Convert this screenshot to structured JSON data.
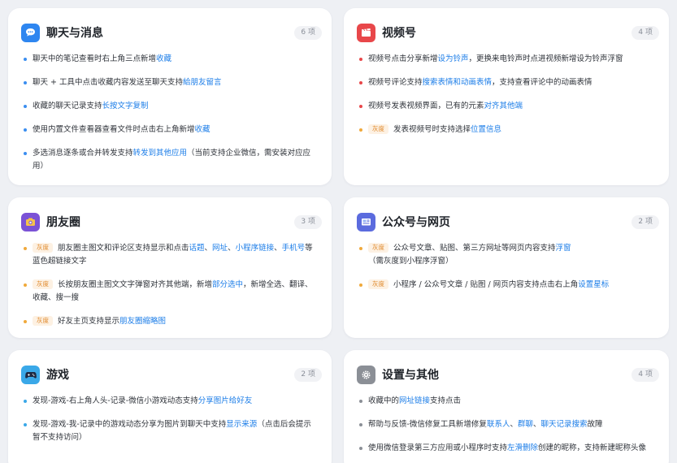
{
  "colors": {
    "accent_link": "#1d7ee8",
    "badge_orange": "#e0892b",
    "chat_icon": "#2e86f0",
    "channels_icon": "#e8474a",
    "moments_icon": "#7b52d6",
    "official_icon": "#5b6bde",
    "games_icon": "#3aa8e8",
    "settings_icon": "#8b8f96"
  },
  "cards": [
    {
      "id": "chat",
      "icon": "chat-bubble-icon",
      "title": "聊天与消息",
      "count": "6 项",
      "dot_color": "#3a8ef0",
      "items": [
        {
          "parts": [
            {
              "t": "聊天中的笔记查看时右上角三点新增"
            },
            {
              "t": "收藏",
              "hl": true
            }
          ]
        },
        {
          "parts": [
            {
              "t": "聊天 + 工具中点击收藏内容发送至聊天支持"
            },
            {
              "t": "給朋友留言",
              "hl": true
            }
          ]
        },
        {
          "parts": [
            {
              "t": "收藏的聊天记录支持"
            },
            {
              "t": "长按文字复制",
              "hl": true
            }
          ]
        },
        {
          "parts": [
            {
              "t": "使用内置文件查看器查看文件时点击右上角新增"
            },
            {
              "t": "收藏",
              "hl": true
            }
          ]
        },
        {
          "parts": [
            {
              "t": "多选消息逐条或合并转发支持"
            },
            {
              "t": "转发到其他应用",
              "hl": true
            },
            {
              "t": "（当前支持企业微信，需安装对应应用）"
            }
          ]
        }
      ]
    },
    {
      "id": "channels",
      "icon": "clapperboard-icon",
      "title": "视频号",
      "count": "4 项",
      "dot_color": "#e8474a",
      "items": [
        {
          "parts": [
            {
              "t": "视频号点击分享新增"
            },
            {
              "t": "设为铃声",
              "hl": true
            },
            {
              "t": "，更换来电铃声时点进视频新增设为铃声浮窗"
            }
          ]
        },
        {
          "parts": [
            {
              "t": "视频号评论支持"
            },
            {
              "t": "搜索表情和动画表情",
              "hl": true
            },
            {
              "t": "，支持查看评论中的动画表情"
            }
          ]
        },
        {
          "parts": [
            {
              "t": "视频号发表视频界面，已有的元素"
            },
            {
              "t": "对齐其他端",
              "hl": true
            }
          ]
        },
        {
          "badge": "灰度",
          "dot_color": "#f0a93b",
          "parts": [
            {
              "t": "发表视频号时支持选择"
            },
            {
              "t": "位置信息",
              "hl": true
            }
          ]
        }
      ]
    },
    {
      "id": "moments",
      "icon": "camera-icon",
      "title": "朋友圈",
      "count": "3 项",
      "dot_color": "#f0a93b",
      "items": [
        {
          "badge": "灰度",
          "parts": [
            {
              "t": "朋友圈主图文和评论区支持显示和点击"
            },
            {
              "t": "话题",
              "hl": true
            },
            {
              "t": "、"
            },
            {
              "t": "网址",
              "hl": true
            },
            {
              "t": "、"
            },
            {
              "t": "小程序链接",
              "hl": true
            },
            {
              "t": "、"
            },
            {
              "t": "手机号",
              "hl": true
            },
            {
              "t": "等蓝色超链接文字"
            }
          ]
        },
        {
          "badge": "灰度",
          "parts": [
            {
              "t": "长按朋友圈主图文文字弹窗对齐其他端，新增"
            },
            {
              "t": "部分选中",
              "hl": true
            },
            {
              "t": "，新增全选、翻译、收藏、搜一搜"
            }
          ]
        },
        {
          "badge": "灰度",
          "parts": [
            {
              "t": "好友主页支持显示"
            },
            {
              "t": "朋友圈缩略图",
              "hl": true
            }
          ]
        }
      ]
    },
    {
      "id": "official",
      "icon": "newspaper-icon",
      "title": "公众号与网页",
      "count": "2 项",
      "dot_color": "#f0a93b",
      "items": [
        {
          "badge": "灰度",
          "parts": [
            {
              "t": "公众号文章、贴图、第三方网址等网页内容支持"
            },
            {
              "t": "浮窗",
              "hl": true
            },
            {
              "t": "（需灰度到小程序浮窗）"
            }
          ]
        },
        {
          "badge": "灰度",
          "parts": [
            {
              "t": "小程序 / 公众号文章 / 贴图 / 网页内容支持点击右上角"
            },
            {
              "t": "设置星标",
              "hl": true
            }
          ]
        }
      ]
    },
    {
      "id": "games",
      "icon": "gamepad-icon",
      "title": "游戏",
      "count": "2 项",
      "dot_color": "#3aa8e8",
      "items": [
        {
          "parts": [
            {
              "t": "发现-游戏-右上角人头-记录-微信小游戏动态支持"
            },
            {
              "t": "分享图片给好友",
              "hl": true
            }
          ]
        },
        {
          "parts": [
            {
              "t": "发现-游戏-我-记录中的游戏动态分享为图片到聊天中支持"
            },
            {
              "t": "显示来源",
              "hl": true
            },
            {
              "t": "（点击后会提示暂不支持访问）"
            }
          ]
        }
      ]
    },
    {
      "id": "settings",
      "icon": "gear-icon",
      "title": "设置与其他",
      "count": "4 项",
      "dot_color": "#8b8f96",
      "items": [
        {
          "parts": [
            {
              "t": "收藏中的"
            },
            {
              "t": "网址链接",
              "hl": true
            },
            {
              "t": "支持点击"
            }
          ]
        },
        {
          "parts": [
            {
              "t": "帮助与反馈-微信修复工具新增修复"
            },
            {
              "t": "联系人",
              "hl": true
            },
            {
              "t": "、"
            },
            {
              "t": "群聊",
              "hl": true
            },
            {
              "t": "、"
            },
            {
              "t": "聊天记录搜索",
              "hl": true
            },
            {
              "t": "故障"
            }
          ]
        },
        {
          "parts": [
            {
              "t": "使用微信登录第三方应用或小程序时支持"
            },
            {
              "t": "左滑删除",
              "hl": true
            },
            {
              "t": "创建的昵称，支持新建昵称头像"
            }
          ]
        }
      ]
    }
  ]
}
